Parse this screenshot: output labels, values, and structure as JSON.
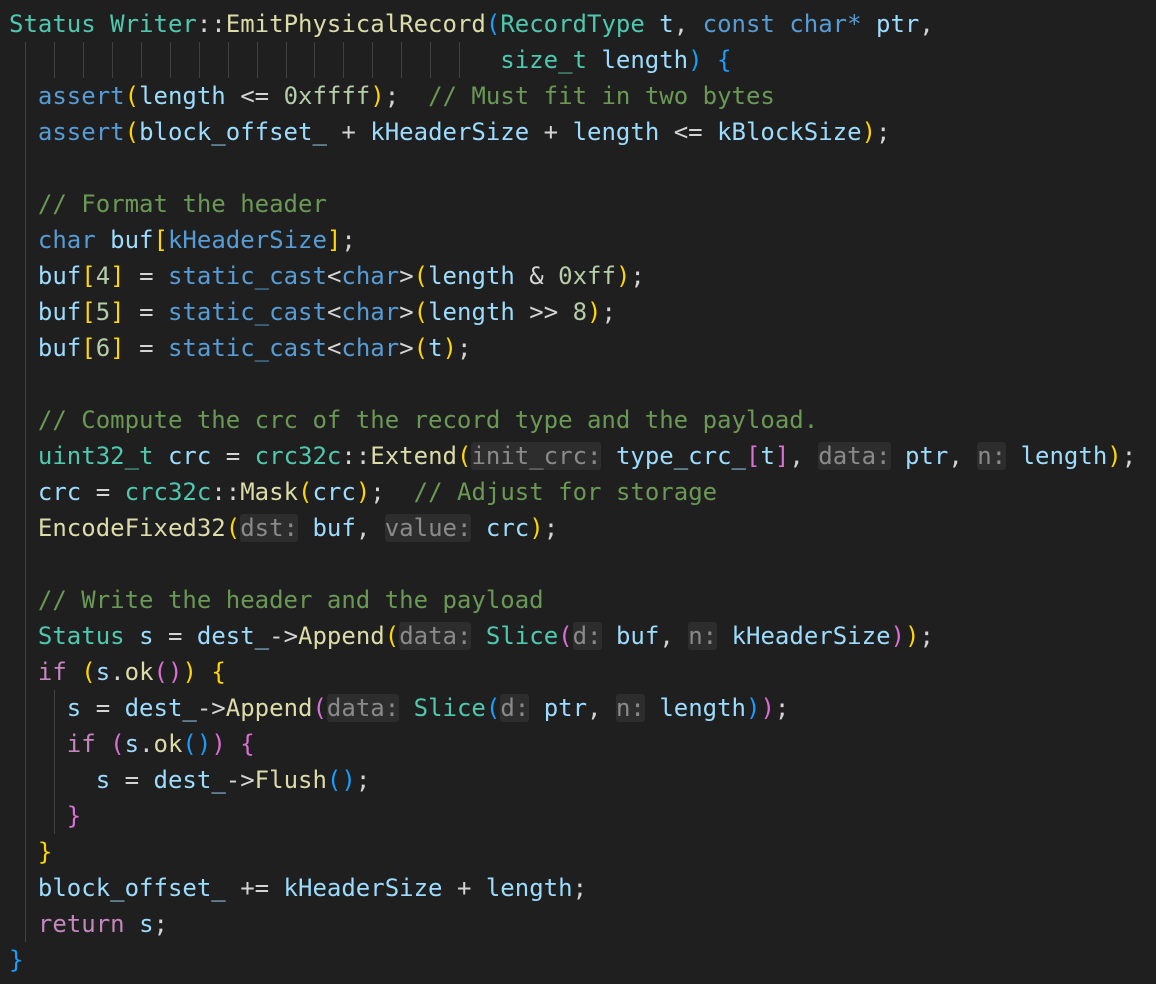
{
  "editor": {
    "language": "cpp",
    "colors": {
      "background": "#1f1f1f",
      "keyword": "#569cd6",
      "type": "#4ec9b0",
      "function": "#dcdcaa",
      "variable": "#9cdcfe",
      "comment": "#6a9955",
      "number": "#b5cea8",
      "control": "#c586c0",
      "bracket_1": "#ffd700",
      "bracket_2": "#da70d6",
      "bracket_3": "#179fff"
    },
    "lines": [
      {
        "guides": [],
        "tokens": [
          [
            "ty",
            "Status"
          ],
          [
            "p",
            " "
          ],
          [
            "ty",
            "Writer"
          ],
          [
            "p",
            "::"
          ],
          [
            "fn",
            "EmitPhysicalRecord"
          ],
          [
            "b3",
            "("
          ],
          [
            "ty",
            "RecordType"
          ],
          [
            "p",
            " "
          ],
          [
            "v",
            "t"
          ],
          [
            "p",
            ", "
          ],
          [
            "k",
            "const"
          ],
          [
            "p",
            " "
          ],
          [
            "k",
            "char"
          ],
          [
            "k",
            "*"
          ],
          [
            "p",
            " "
          ],
          [
            "v",
            "ptr"
          ],
          [
            "p",
            ","
          ]
        ]
      },
      {
        "guides": [
          1,
          2,
          3,
          4,
          5,
          6,
          7,
          8,
          9,
          10,
          11,
          12,
          13,
          14,
          15,
          16,
          17,
          18,
          19,
          20,
          21,
          22,
          23,
          24,
          25,
          26,
          27,
          28,
          29,
          30,
          31,
          32,
          33,
          34,
          35,
          36,
          37,
          38,
          39,
          40,
          41,
          42,
          43,
          44,
          45,
          46,
          47,
          48,
          49,
          50,
          51,
          52,
          53,
          54,
          55,
          56,
          57,
          58,
          59,
          60,
          61,
          62,
          63,
          64,
          65,
          66,
          67,
          68,
          69,
          70
        ],
        "tokens": [
          [
            "p",
            "                                  "
          ],
          [
            "ty",
            "size_t"
          ],
          [
            "p",
            " "
          ],
          [
            "v",
            "length"
          ],
          [
            "b3",
            ")"
          ],
          [
            "p",
            " "
          ],
          [
            "b3",
            "{"
          ]
        ]
      },
      {
        "guides": [
          2
        ],
        "tokens": [
          [
            "p",
            "  "
          ],
          [
            "k",
            "assert"
          ],
          [
            "b1",
            "("
          ],
          [
            "v",
            "length"
          ],
          [
            "p",
            " <= "
          ],
          [
            "n",
            "0xffff"
          ],
          [
            "b1",
            ")"
          ],
          [
            "p",
            ";  "
          ],
          [
            "c",
            "// Must fit in two bytes"
          ]
        ]
      },
      {
        "guides": [
          2
        ],
        "tokens": [
          [
            "p",
            "  "
          ],
          [
            "k",
            "assert"
          ],
          [
            "b1",
            "("
          ],
          [
            "v",
            "block_offset_"
          ],
          [
            "p",
            " + "
          ],
          [
            "v",
            "kHeaderSize"
          ],
          [
            "p",
            " + "
          ],
          [
            "v",
            "length"
          ],
          [
            "p",
            " <= "
          ],
          [
            "v",
            "kBlockSize"
          ],
          [
            "b1",
            ")"
          ],
          [
            "p",
            ";"
          ]
        ]
      },
      {
        "guides": [
          2
        ],
        "tokens": []
      },
      {
        "guides": [
          2
        ],
        "tokens": [
          [
            "p",
            "  "
          ],
          [
            "c",
            "// Format the header"
          ]
        ]
      },
      {
        "guides": [
          2
        ],
        "tokens": [
          [
            "p",
            "  "
          ],
          [
            "k",
            "char"
          ],
          [
            "p",
            " "
          ],
          [
            "v",
            "buf"
          ],
          [
            "b1",
            "["
          ],
          [
            "k",
            "kHeaderSize"
          ],
          [
            "b1",
            "]"
          ],
          [
            "p",
            ";"
          ]
        ]
      },
      {
        "guides": [
          2
        ],
        "tokens": [
          [
            "p",
            "  "
          ],
          [
            "v",
            "buf"
          ],
          [
            "b1",
            "["
          ],
          [
            "n",
            "4"
          ],
          [
            "b1",
            "]"
          ],
          [
            "p",
            " = "
          ],
          [
            "k",
            "static_cast"
          ],
          [
            "p",
            "<"
          ],
          [
            "k",
            "char"
          ],
          [
            "p",
            ">"
          ],
          [
            "b1",
            "("
          ],
          [
            "v",
            "length"
          ],
          [
            "p",
            " & "
          ],
          [
            "n",
            "0xff"
          ],
          [
            "b1",
            ")"
          ],
          [
            "p",
            ";"
          ]
        ]
      },
      {
        "guides": [
          2
        ],
        "tokens": [
          [
            "p",
            "  "
          ],
          [
            "v",
            "buf"
          ],
          [
            "b1",
            "["
          ],
          [
            "n",
            "5"
          ],
          [
            "b1",
            "]"
          ],
          [
            "p",
            " = "
          ],
          [
            "k",
            "static_cast"
          ],
          [
            "p",
            "<"
          ],
          [
            "k",
            "char"
          ],
          [
            "p",
            ">"
          ],
          [
            "b1",
            "("
          ],
          [
            "v",
            "length"
          ],
          [
            "p",
            " >> "
          ],
          [
            "n",
            "8"
          ],
          [
            "b1",
            ")"
          ],
          [
            "p",
            ";"
          ]
        ]
      },
      {
        "guides": [
          2
        ],
        "tokens": [
          [
            "p",
            "  "
          ],
          [
            "v",
            "buf"
          ],
          [
            "b1",
            "["
          ],
          [
            "n",
            "6"
          ],
          [
            "b1",
            "]"
          ],
          [
            "p",
            " = "
          ],
          [
            "k",
            "static_cast"
          ],
          [
            "p",
            "<"
          ],
          [
            "k",
            "char"
          ],
          [
            "p",
            ">"
          ],
          [
            "b1",
            "("
          ],
          [
            "v",
            "t"
          ],
          [
            "b1",
            ")"
          ],
          [
            "p",
            ";"
          ]
        ]
      },
      {
        "guides": [
          2
        ],
        "tokens": []
      },
      {
        "guides": [
          2
        ],
        "tokens": [
          [
            "p",
            "  "
          ],
          [
            "c",
            "// Compute the crc of the record type and the payload."
          ]
        ]
      },
      {
        "guides": [
          2
        ],
        "tokens": [
          [
            "p",
            "  "
          ],
          [
            "ty",
            "uint32_t"
          ],
          [
            "p",
            " "
          ],
          [
            "v",
            "crc"
          ],
          [
            "p",
            " = "
          ],
          [
            "ty",
            "crc32c"
          ],
          [
            "p",
            "::"
          ],
          [
            "fn",
            "Extend"
          ],
          [
            "b1",
            "("
          ],
          [
            "hint",
            "init_crc:"
          ],
          [
            "p",
            " "
          ],
          [
            "v",
            "type_crc_"
          ],
          [
            "b2",
            "["
          ],
          [
            "v",
            "t"
          ],
          [
            "b2",
            "]"
          ],
          [
            "p",
            ", "
          ],
          [
            "hint",
            "data:"
          ],
          [
            "p",
            " "
          ],
          [
            "v",
            "ptr"
          ],
          [
            "p",
            ", "
          ],
          [
            "hint",
            "n:"
          ],
          [
            "p",
            " "
          ],
          [
            "v",
            "length"
          ],
          [
            "b1",
            ")"
          ],
          [
            "p",
            ";"
          ]
        ]
      },
      {
        "guides": [
          2
        ],
        "tokens": [
          [
            "p",
            "  "
          ],
          [
            "v",
            "crc"
          ],
          [
            "p",
            " = "
          ],
          [
            "ty",
            "crc32c"
          ],
          [
            "p",
            "::"
          ],
          [
            "fn",
            "Mask"
          ],
          [
            "b1",
            "("
          ],
          [
            "v",
            "crc"
          ],
          [
            "b1",
            ")"
          ],
          [
            "p",
            ";  "
          ],
          [
            "c",
            "// Adjust for storage"
          ]
        ]
      },
      {
        "guides": [
          2
        ],
        "tokens": [
          [
            "p",
            "  "
          ],
          [
            "fn",
            "EncodeFixed32"
          ],
          [
            "b1",
            "("
          ],
          [
            "hint",
            "dst:"
          ],
          [
            "p",
            " "
          ],
          [
            "v",
            "buf"
          ],
          [
            "p",
            ", "
          ],
          [
            "hint",
            "value:"
          ],
          [
            "p",
            " "
          ],
          [
            "v",
            "crc"
          ],
          [
            "b1",
            ")"
          ],
          [
            "p",
            ";"
          ]
        ]
      },
      {
        "guides": [
          2
        ],
        "tokens": []
      },
      {
        "guides": [
          2
        ],
        "tokens": [
          [
            "p",
            "  "
          ],
          [
            "c",
            "// Write the header and the payload"
          ]
        ]
      },
      {
        "guides": [
          2
        ],
        "tokens": [
          [
            "p",
            "  "
          ],
          [
            "ty",
            "Status"
          ],
          [
            "p",
            " "
          ],
          [
            "v",
            "s"
          ],
          [
            "p",
            " = "
          ],
          [
            "v",
            "dest_"
          ],
          [
            "p",
            "->"
          ],
          [
            "fn",
            "Append"
          ],
          [
            "b1",
            "("
          ],
          [
            "hint",
            "data:"
          ],
          [
            "p",
            " "
          ],
          [
            "ty",
            "Slice"
          ],
          [
            "b2",
            "("
          ],
          [
            "hint",
            "d:"
          ],
          [
            "p",
            " "
          ],
          [
            "v",
            "buf"
          ],
          [
            "p",
            ", "
          ],
          [
            "hint",
            "n:"
          ],
          [
            "p",
            " "
          ],
          [
            "v",
            "kHeaderSize"
          ],
          [
            "b2",
            ")"
          ],
          [
            "b1",
            ")"
          ],
          [
            "p",
            ";"
          ]
        ]
      },
      {
        "guides": [
          2
        ],
        "tokens": [
          [
            "p",
            "  "
          ],
          [
            "ct",
            "if"
          ],
          [
            "p",
            " "
          ],
          [
            "b1",
            "("
          ],
          [
            "v",
            "s"
          ],
          [
            "p",
            "."
          ],
          [
            "fn",
            "ok"
          ],
          [
            "b2",
            "("
          ],
          [
            "b2",
            ")"
          ],
          [
            "b1",
            ")"
          ],
          [
            "p",
            " "
          ],
          [
            "b1",
            "{"
          ]
        ]
      },
      {
        "guides": [
          2,
          4
        ],
        "tokens": [
          [
            "p",
            "    "
          ],
          [
            "v",
            "s"
          ],
          [
            "p",
            " = "
          ],
          [
            "v",
            "dest_"
          ],
          [
            "p",
            "->"
          ],
          [
            "fn",
            "Append"
          ],
          [
            "b2",
            "("
          ],
          [
            "hint",
            "data:"
          ],
          [
            "p",
            " "
          ],
          [
            "ty",
            "Slice"
          ],
          [
            "b3",
            "("
          ],
          [
            "hint",
            "d:"
          ],
          [
            "p",
            " "
          ],
          [
            "v",
            "ptr"
          ],
          [
            "p",
            ", "
          ],
          [
            "hint",
            "n:"
          ],
          [
            "p",
            " "
          ],
          [
            "v",
            "length"
          ],
          [
            "b3",
            ")"
          ],
          [
            "b2",
            ")"
          ],
          [
            "p",
            ";"
          ]
        ]
      },
      {
        "guides": [
          2,
          4
        ],
        "tokens": [
          [
            "p",
            "    "
          ],
          [
            "ct",
            "if"
          ],
          [
            "p",
            " "
          ],
          [
            "b2",
            "("
          ],
          [
            "v",
            "s"
          ],
          [
            "p",
            "."
          ],
          [
            "fn",
            "ok"
          ],
          [
            "b3",
            "("
          ],
          [
            "b3",
            ")"
          ],
          [
            "b2",
            ")"
          ],
          [
            "p",
            " "
          ],
          [
            "b2",
            "{"
          ]
        ]
      },
      {
        "guides": [
          2,
          4
        ],
        "tokens": [
          [
            "p",
            "      "
          ],
          [
            "v",
            "s"
          ],
          [
            "p",
            " = "
          ],
          [
            "v",
            "dest_"
          ],
          [
            "p",
            "->"
          ],
          [
            "fn",
            "Flush"
          ],
          [
            "b3",
            "("
          ],
          [
            "b3",
            ")"
          ],
          [
            "p",
            ";"
          ]
        ]
      },
      {
        "guides": [
          2,
          4
        ],
        "tokens": [
          [
            "p",
            "    "
          ],
          [
            "b2",
            "}"
          ]
        ]
      },
      {
        "guides": [
          2
        ],
        "tokens": [
          [
            "p",
            "  "
          ],
          [
            "b1",
            "}"
          ]
        ]
      },
      {
        "guides": [
          2
        ],
        "tokens": [
          [
            "p",
            "  "
          ],
          [
            "v",
            "block_offset_"
          ],
          [
            "p",
            " += "
          ],
          [
            "v",
            "kHeaderSize"
          ],
          [
            "p",
            " + "
          ],
          [
            "v",
            "length"
          ],
          [
            "p",
            ";"
          ]
        ]
      },
      {
        "guides": [
          2
        ],
        "tokens": [
          [
            "p",
            "  "
          ],
          [
            "ct",
            "return"
          ],
          [
            "p",
            " "
          ],
          [
            "v",
            "s"
          ],
          [
            "p",
            ";"
          ]
        ]
      },
      {
        "guides": [],
        "tokens": [
          [
            "b3",
            "}"
          ]
        ]
      }
    ]
  }
}
